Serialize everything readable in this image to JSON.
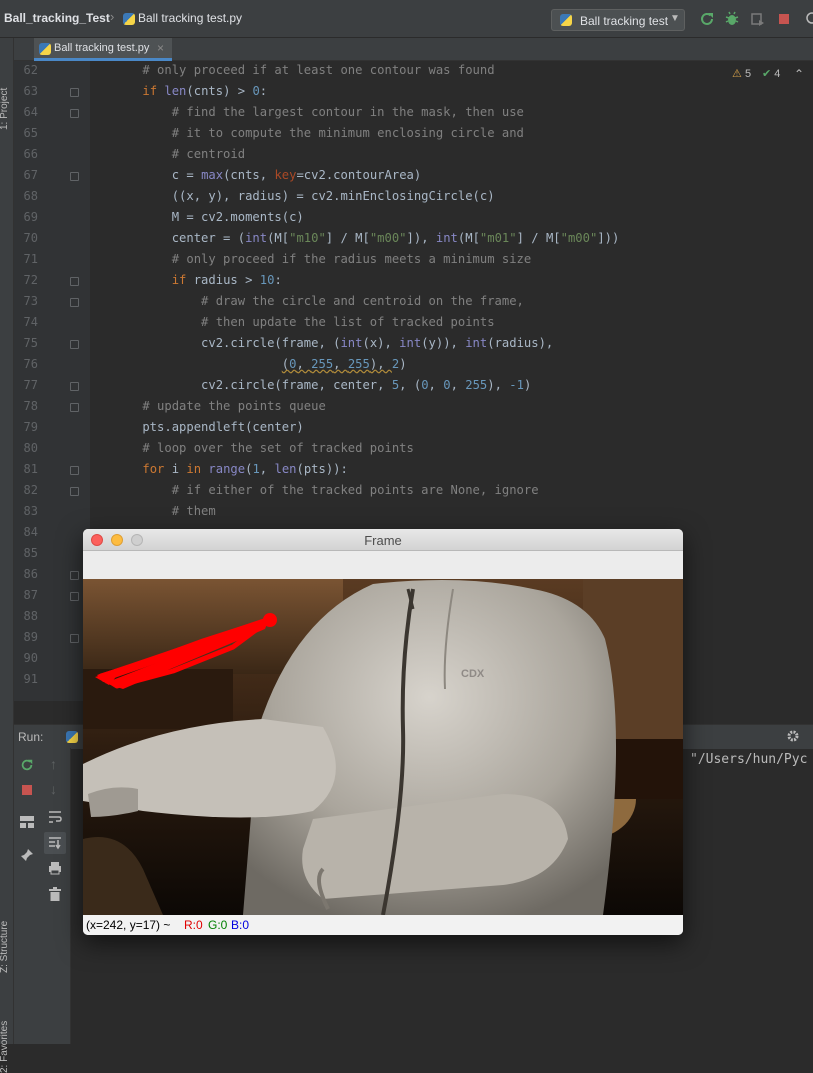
{
  "header": {
    "project": "Ball_tracking_Test",
    "file": "Ball tracking test.py",
    "run_config": "Ball tracking test"
  },
  "editor": {
    "tab_label": "Ball tracking test.py",
    "tab_close": "×",
    "warnings": "5",
    "checks": "4",
    "lines": [
      {
        "n": "62",
        "c": [
          {
            "t": "    # only proceed if at least one contour was found",
            "k": "cm"
          }
        ]
      },
      {
        "n": "63",
        "c": [
          {
            "t": "    "
          },
          {
            "t": "if ",
            "k": "kw"
          },
          {
            "t": "len",
            "k": "bi"
          },
          {
            "t": "(cnts) > "
          },
          {
            "t": "0",
            "k": "num"
          },
          {
            "t": ":"
          }
        ]
      },
      {
        "n": "64",
        "c": [
          {
            "t": "        # find the largest contour in the mask, then use",
            "k": "cm"
          }
        ]
      },
      {
        "n": "65",
        "c": [
          {
            "t": "        # it to compute the minimum enclosing circle and",
            "k": "cm"
          }
        ]
      },
      {
        "n": "66",
        "c": [
          {
            "t": "        # centroid",
            "k": "cm"
          }
        ]
      },
      {
        "n": "67",
        "c": [
          {
            "t": "        c = "
          },
          {
            "t": "max",
            "k": "bi"
          },
          {
            "t": "(cnts, "
          },
          {
            "t": "key",
            "k": "kwarg"
          },
          {
            "t": "=cv2.contourArea)"
          }
        ]
      },
      {
        "n": "68",
        "c": [
          {
            "t": "        ((x, y), radius) = cv2.minEnclosingCircle(c)"
          }
        ]
      },
      {
        "n": "69",
        "c": [
          {
            "t": "        M = cv2.moments(c)"
          }
        ]
      },
      {
        "n": "70",
        "c": [
          {
            "t": "        center = ("
          },
          {
            "t": "int",
            "k": "bi"
          },
          {
            "t": "(M["
          },
          {
            "t": "\"m10\"",
            "k": "str"
          },
          {
            "t": "] / M["
          },
          {
            "t": "\"m00\"",
            "k": "str"
          },
          {
            "t": "]), "
          },
          {
            "t": "int",
            "k": "bi"
          },
          {
            "t": "(M["
          },
          {
            "t": "\"m01\"",
            "k": "str"
          },
          {
            "t": "] / M["
          },
          {
            "t": "\"m00\"",
            "k": "str"
          },
          {
            "t": "]))"
          }
        ]
      },
      {
        "n": "71",
        "c": [
          {
            "t": "        # only proceed if the radius meets a minimum size",
            "k": "cm"
          }
        ]
      },
      {
        "n": "72",
        "c": [
          {
            "t": "        "
          },
          {
            "t": "if ",
            "k": "kw"
          },
          {
            "t": "radius > "
          },
          {
            "t": "10",
            "k": "num"
          },
          {
            "t": ":"
          }
        ]
      },
      {
        "n": "73",
        "c": [
          {
            "t": "            # draw the circle and centroid on the frame,",
            "k": "cm"
          }
        ]
      },
      {
        "n": "74",
        "c": [
          {
            "t": "            # then update the list of tracked points",
            "k": "cm"
          }
        ]
      },
      {
        "n": "75",
        "c": [
          {
            "t": "            cv2.circle(frame, ("
          },
          {
            "t": "int",
            "k": "bi"
          },
          {
            "t": "(x), "
          },
          {
            "t": "int",
            "k": "bi"
          },
          {
            "t": "(y)), "
          },
          {
            "t": "int",
            "k": "bi"
          },
          {
            "t": "(radius),"
          }
        ]
      },
      {
        "n": "76",
        "c": [
          {
            "t": "                       "
          },
          {
            "t": "(",
            "k": "wv"
          },
          {
            "t": "0",
            "k": "numwv"
          },
          {
            "t": ", ",
            "k": "wv"
          },
          {
            "t": "255",
            "k": "numwv"
          },
          {
            "t": ", ",
            "k": "wv"
          },
          {
            "t": "255",
            "k": "numwv"
          },
          {
            "t": "), ",
            "k": "wv"
          },
          {
            "t": "2",
            "k": "num"
          },
          {
            "t": ")"
          }
        ]
      },
      {
        "n": "77",
        "c": [
          {
            "t": "            cv2.circle(frame, center, "
          },
          {
            "t": "5",
            "k": "num"
          },
          {
            "t": ", ("
          },
          {
            "t": "0",
            "k": "num"
          },
          {
            "t": ", "
          },
          {
            "t": "0",
            "k": "num"
          },
          {
            "t": ", "
          },
          {
            "t": "255",
            "k": "num"
          },
          {
            "t": "), "
          },
          {
            "t": "-1",
            "k": "num"
          },
          {
            "t": ")"
          }
        ]
      },
      {
        "n": "78",
        "c": [
          {
            "t": "    # update the points queue",
            "k": "cm"
          }
        ]
      },
      {
        "n": "79",
        "c": [
          {
            "t": "    pts.appendleft(center)"
          }
        ]
      },
      {
        "n": "80",
        "c": [
          {
            "t": "    # loop over the set of tracked points",
            "k": "cm"
          }
        ]
      },
      {
        "n": "81",
        "c": [
          {
            "t": "    "
          },
          {
            "t": "for ",
            "k": "kw"
          },
          {
            "t": "i "
          },
          {
            "t": "in ",
            "k": "kw"
          },
          {
            "t": "range",
            "k": "bi"
          },
          {
            "t": "("
          },
          {
            "t": "1",
            "k": "num"
          },
          {
            "t": ", "
          },
          {
            "t": "len",
            "k": "bi"
          },
          {
            "t": "(pts)):"
          }
        ]
      },
      {
        "n": "82",
        "c": [
          {
            "t": "        # if either of the tracked points are None, ignore",
            "k": "cm"
          }
        ]
      },
      {
        "n": "83",
        "c": [
          {
            "t": "        # them",
            "k": "cm"
          }
        ]
      },
      {
        "n": "84",
        "c": []
      },
      {
        "n": "85",
        "c": []
      },
      {
        "n": "86",
        "c": []
      },
      {
        "n": "87",
        "c": []
      },
      {
        "n": "88",
        "c": []
      },
      {
        "n": "89",
        "c": []
      },
      {
        "n": "90",
        "c": []
      },
      {
        "n": "91",
        "c": []
      }
    ]
  },
  "sidebar": {
    "project_tab": "1: Project",
    "structure_tab": "Z: Structure",
    "favorites_tab": "2: Favorites"
  },
  "run_panel": {
    "label": "Run:",
    "console_text": "\"/Users/hun/Pyc"
  },
  "frame_window": {
    "title": "Frame",
    "status_coords": "(x=242, y=17) ~",
    "status_r": "R:0",
    "status_g": "G:0",
    "status_b": "B:0",
    "hoodie_logo": "CDX"
  },
  "colors": {
    "keyword": "#cc7832",
    "comment": "#808080",
    "number": "#6897bb",
    "string": "#6a8759",
    "builtin": "#8888c6",
    "kwarg": "#aa4926",
    "tracking_line": "#ff0000"
  }
}
